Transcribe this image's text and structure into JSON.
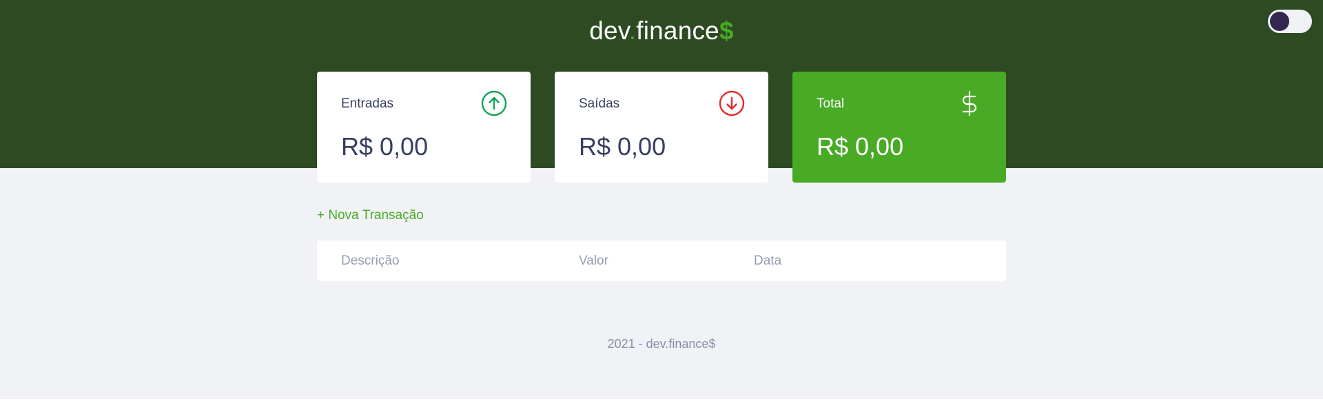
{
  "header": {
    "logo": {
      "part1": "dev",
      "dot": ".",
      "part2": "finance",
      "dollar": "$"
    },
    "theme_toggle": {
      "state": "dark"
    }
  },
  "cards": [
    {
      "label": "Entradas",
      "value": "R$ 0,00",
      "icon": "arrow-up-circle-icon",
      "icon_color": "#12a454"
    },
    {
      "label": "Saídas",
      "value": "R$ 0,00",
      "icon": "arrow-down-circle-icon",
      "icon_color": "#e92929"
    },
    {
      "label": "Total",
      "value": "R$ 0,00",
      "icon": "dollar-sign-icon",
      "icon_color": "#ffffff"
    }
  ],
  "actions": {
    "new_transaction": "+ Nova Transação"
  },
  "table": {
    "headers": [
      "Descrição",
      "Valor",
      "Data"
    ],
    "rows": []
  },
  "footer": {
    "text": "2021 - dev.finance$"
  },
  "colors": {
    "header_bg": "#2d4a22",
    "accent": "#49aa26",
    "page_bg": "#f0f2f5",
    "text": "#363f5f",
    "muted": "#969cb3"
  }
}
